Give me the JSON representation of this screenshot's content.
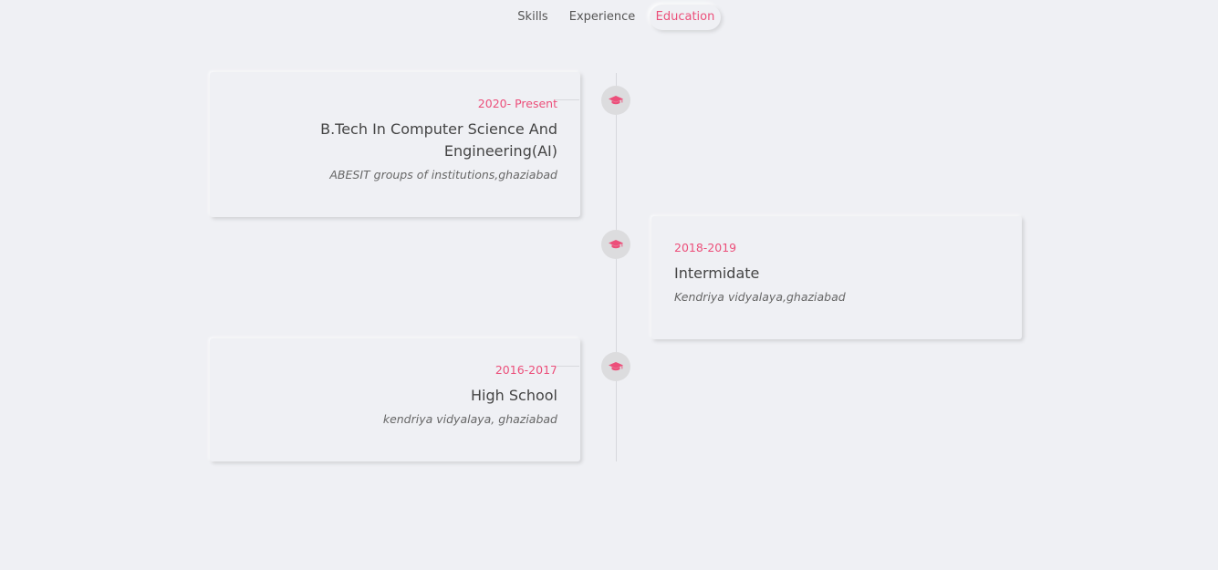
{
  "tabs": [
    {
      "label": "Skills",
      "active": false
    },
    {
      "label": "Experience",
      "active": false
    },
    {
      "label": "Education",
      "active": true
    }
  ],
  "accent_color": "#ec4f7a",
  "timeline_icon": "graduation-cap-icon",
  "education": [
    {
      "date": "2020- Present",
      "title": "B.Tech In Computer Science And Engineering(AI)",
      "place": "ABESIT groups of institutions,ghaziabad",
      "side": "left"
    },
    {
      "date": "2018-2019",
      "title": "Intermidate",
      "place": "Kendriya vidyalaya,ghaziabad",
      "side": "right"
    },
    {
      "date": "2016-2017",
      "title": "High School",
      "place": "kendriya vidyalaya, ghaziabad",
      "side": "left"
    }
  ]
}
